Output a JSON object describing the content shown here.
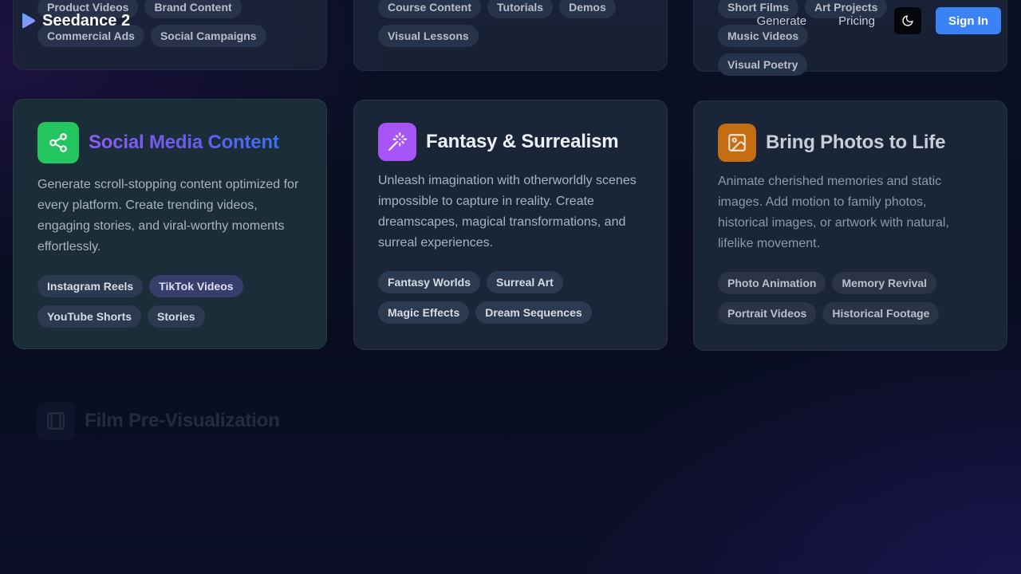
{
  "nav": {
    "logo_text": "Seedance 2",
    "links": [
      "Generate",
      "Pricing"
    ],
    "theme_icon": "moon-icon",
    "sign_in": "Sign In"
  },
  "top_cards": [
    {
      "tags_row1": [
        "Product Videos",
        "Brand Content"
      ],
      "tags_row2": [
        "Commercial Ads",
        "Social Campaigns"
      ]
    },
    {
      "tags_row1": [
        "Course Content",
        "Tutorials",
        "Demos"
      ],
      "tags_row2": [
        "Visual Lessons"
      ]
    },
    {
      "tags_row1": [
        "Short Films",
        "Art Projects",
        "Music Videos"
      ],
      "tags_row2": [
        "Visual Poetry"
      ]
    }
  ],
  "cards": [
    {
      "title": "Social Media Content",
      "icon": "share-icon",
      "icon_color": "#22c55e",
      "description": "Generate scroll-stopping content optimized for every platform. Create trending videos, engaging stories, and viral-worthy moments effortlessly.",
      "tags": [
        "Instagram Reels",
        "TikTok Videos",
        "YouTube Shorts",
        "Stories"
      ]
    },
    {
      "title": "Fantasy & Surrealism",
      "icon": "magic-wand-icon",
      "icon_color": "#a855f7",
      "description": "Unleash imagination with otherworldly scenes impossible to capture in reality. Create dreamscapes, magical transformations, and surreal experiences.",
      "tags": [
        "Fantasy Worlds",
        "Surreal Art",
        "Magic Effects",
        "Dream Sequences"
      ]
    },
    {
      "title": "Bring Photos to Life",
      "icon": "image-icon",
      "icon_color": "#d97706",
      "description": "Animate cherished memories and static images. Add motion to family photos, historical images, or artwork with natural, lifelike movement.",
      "tags": [
        "Photo Animation",
        "Memory Revival",
        "Portrait Videos",
        "Historical Footage"
      ]
    }
  ],
  "faded_card": {
    "title": "Film Pre-Visualization",
    "icon": "film-icon"
  }
}
